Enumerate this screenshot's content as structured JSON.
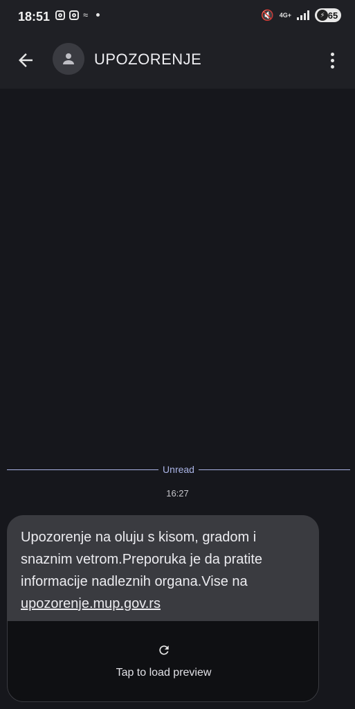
{
  "status_bar": {
    "time": "18:51",
    "network": "4G+",
    "battery": "65"
  },
  "header": {
    "title": "UPOZORENJE"
  },
  "divider": {
    "label": "Unread"
  },
  "message": {
    "timestamp": "16:27",
    "text": "Upozorenje na oluju s kisom, gradom i snaznim vetrom.Preporuka je da pratite informacije nadleznih organa.Vise na",
    "link": "upozorenje.mup.gov.rs",
    "preview_label": "Tap to load preview"
  },
  "colors": {
    "background": "#16171c",
    "accent": "#aab4e6",
    "bubble": "#3a3b40"
  }
}
